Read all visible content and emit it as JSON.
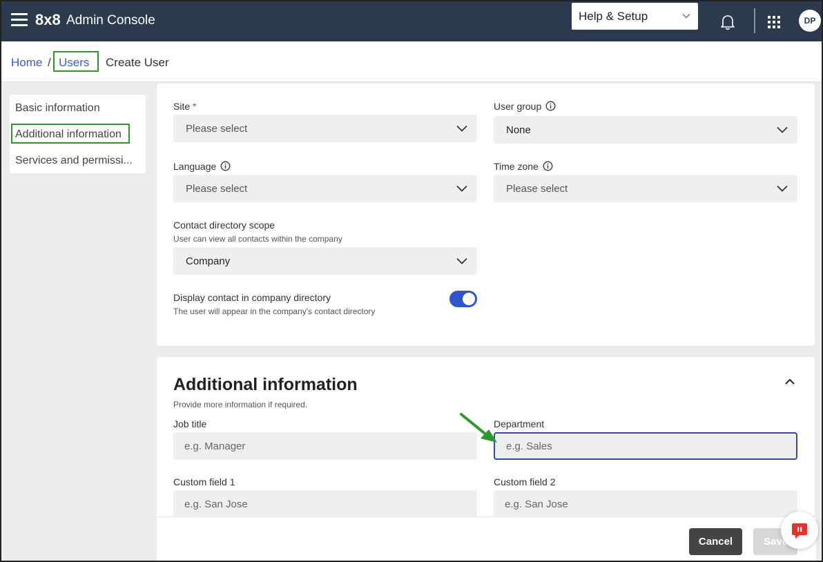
{
  "app": {
    "logo": "8x8",
    "title": "Admin Console",
    "help_menu": "Help & Setup",
    "avatar_initials": "DP"
  },
  "breadcrumb": {
    "home": "Home",
    "sep": "/",
    "users": "Users",
    "current": "Create User"
  },
  "sidebar": {
    "items": [
      "Basic information",
      "Additional information",
      "Services and permissi..."
    ]
  },
  "form": {
    "site_label": "Site",
    "site_required": "*",
    "site_value": "Please select",
    "user_group_label": "User group",
    "user_group_value": "None",
    "language_label": "Language",
    "language_value": "Please select",
    "time_zone_label": "Time zone",
    "time_zone_value": "Please select",
    "contact_scope_label": "Contact directory scope",
    "contact_scope_desc": "User can view all contacts within the company",
    "contact_scope_value": "Company",
    "display_contact_label": "Display contact in company directory",
    "display_contact_desc": "The user will appear in the company's contact directory",
    "display_contact_on": true
  },
  "additional": {
    "title": "Additional information",
    "subtitle": "Provide more information if required.",
    "job_title_label": "Job title",
    "job_title_placeholder": "e.g. Manager",
    "department_label": "Department",
    "department_placeholder": "e.g. Sales",
    "custom1_label": "Custom field 1",
    "custom1_placeholder": "e.g. San Jose",
    "custom2_label": "Custom field 2",
    "custom2_placeholder": "e.g. San Jose"
  },
  "footer": {
    "cancel": "Cancel",
    "save": "Save"
  },
  "colors": {
    "topbar": "#2b3a4c",
    "accent": "#2e55cc",
    "highlight": "#2a9a2a",
    "chat": "#e0342c"
  }
}
